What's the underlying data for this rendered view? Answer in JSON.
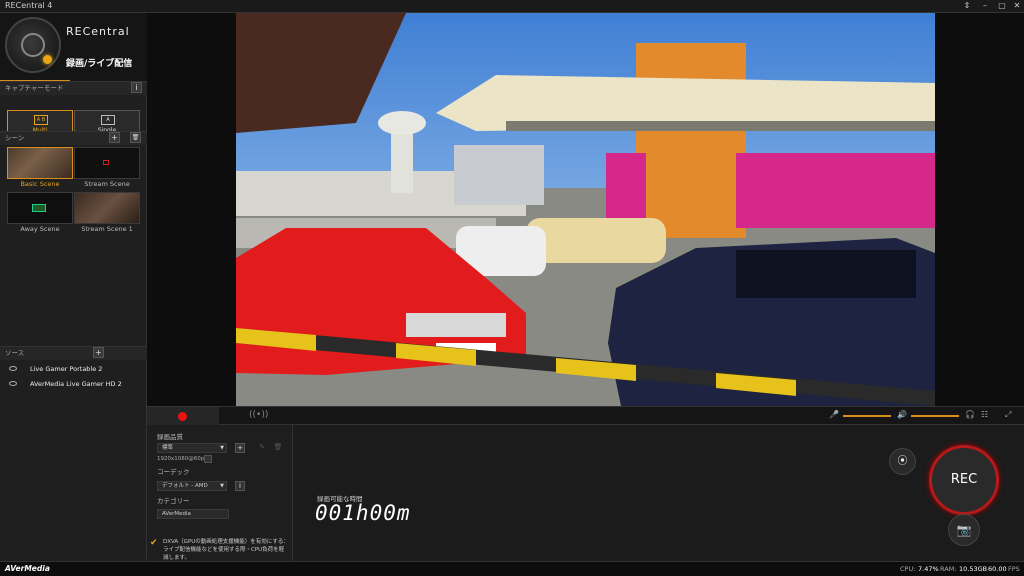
{
  "window": {
    "title": "RECentral 4",
    "controls": [
      "⇕",
      "–",
      "▢",
      "✕"
    ]
  },
  "brand": {
    "name": "RECentral",
    "mode_label": "録画/ライブ配信"
  },
  "capture_mode": {
    "heading": "キャプチャーモード",
    "info": "i",
    "multi_label": "Multi",
    "single_label": "Single",
    "multi_icon": "A B",
    "single_icon": "A"
  },
  "scenes": {
    "heading": "シーン",
    "add": "+",
    "delete": "🗑",
    "items": [
      {
        "label": "Basic Scene"
      },
      {
        "label": "Stream Scene"
      },
      {
        "label": "Away Scene"
      },
      {
        "label": "Stream Scene 1"
      }
    ]
  },
  "sources": {
    "heading": "ソース",
    "add": "+",
    "items": [
      {
        "label": "Live Gamer Portable 2"
      },
      {
        "label": "AVerMedia Live Gamer HD 2"
      }
    ]
  },
  "settings": {
    "quality_label": "録画品質",
    "quality_value": "標準",
    "resolution": "1920x1080@60p",
    "codec_label": "コーデック",
    "codec_value": "デフォルト - AMD",
    "category_label": "カテゴリー",
    "category_value": "AVerMedia",
    "dxva_note": "DXVA（GPUの動画処理支援機能）を有効にする：ライブ配信機能などを使用する際・CPU負荷を軽減します。"
  },
  "recording": {
    "time_label": "録画可能な時間",
    "time_value": "001h00m",
    "rec_label": "REC"
  },
  "status": {
    "cpu_label": "CPU:",
    "cpu_value": "7.47%",
    "ram_label": "RAM:",
    "ram_value": "10.53GB",
    "fps_value": "60.00",
    "fps_label": "FPS"
  },
  "footer_brand": "AVerMedia",
  "colors": {
    "accent": "#d98e1b",
    "record": "#e11111"
  }
}
